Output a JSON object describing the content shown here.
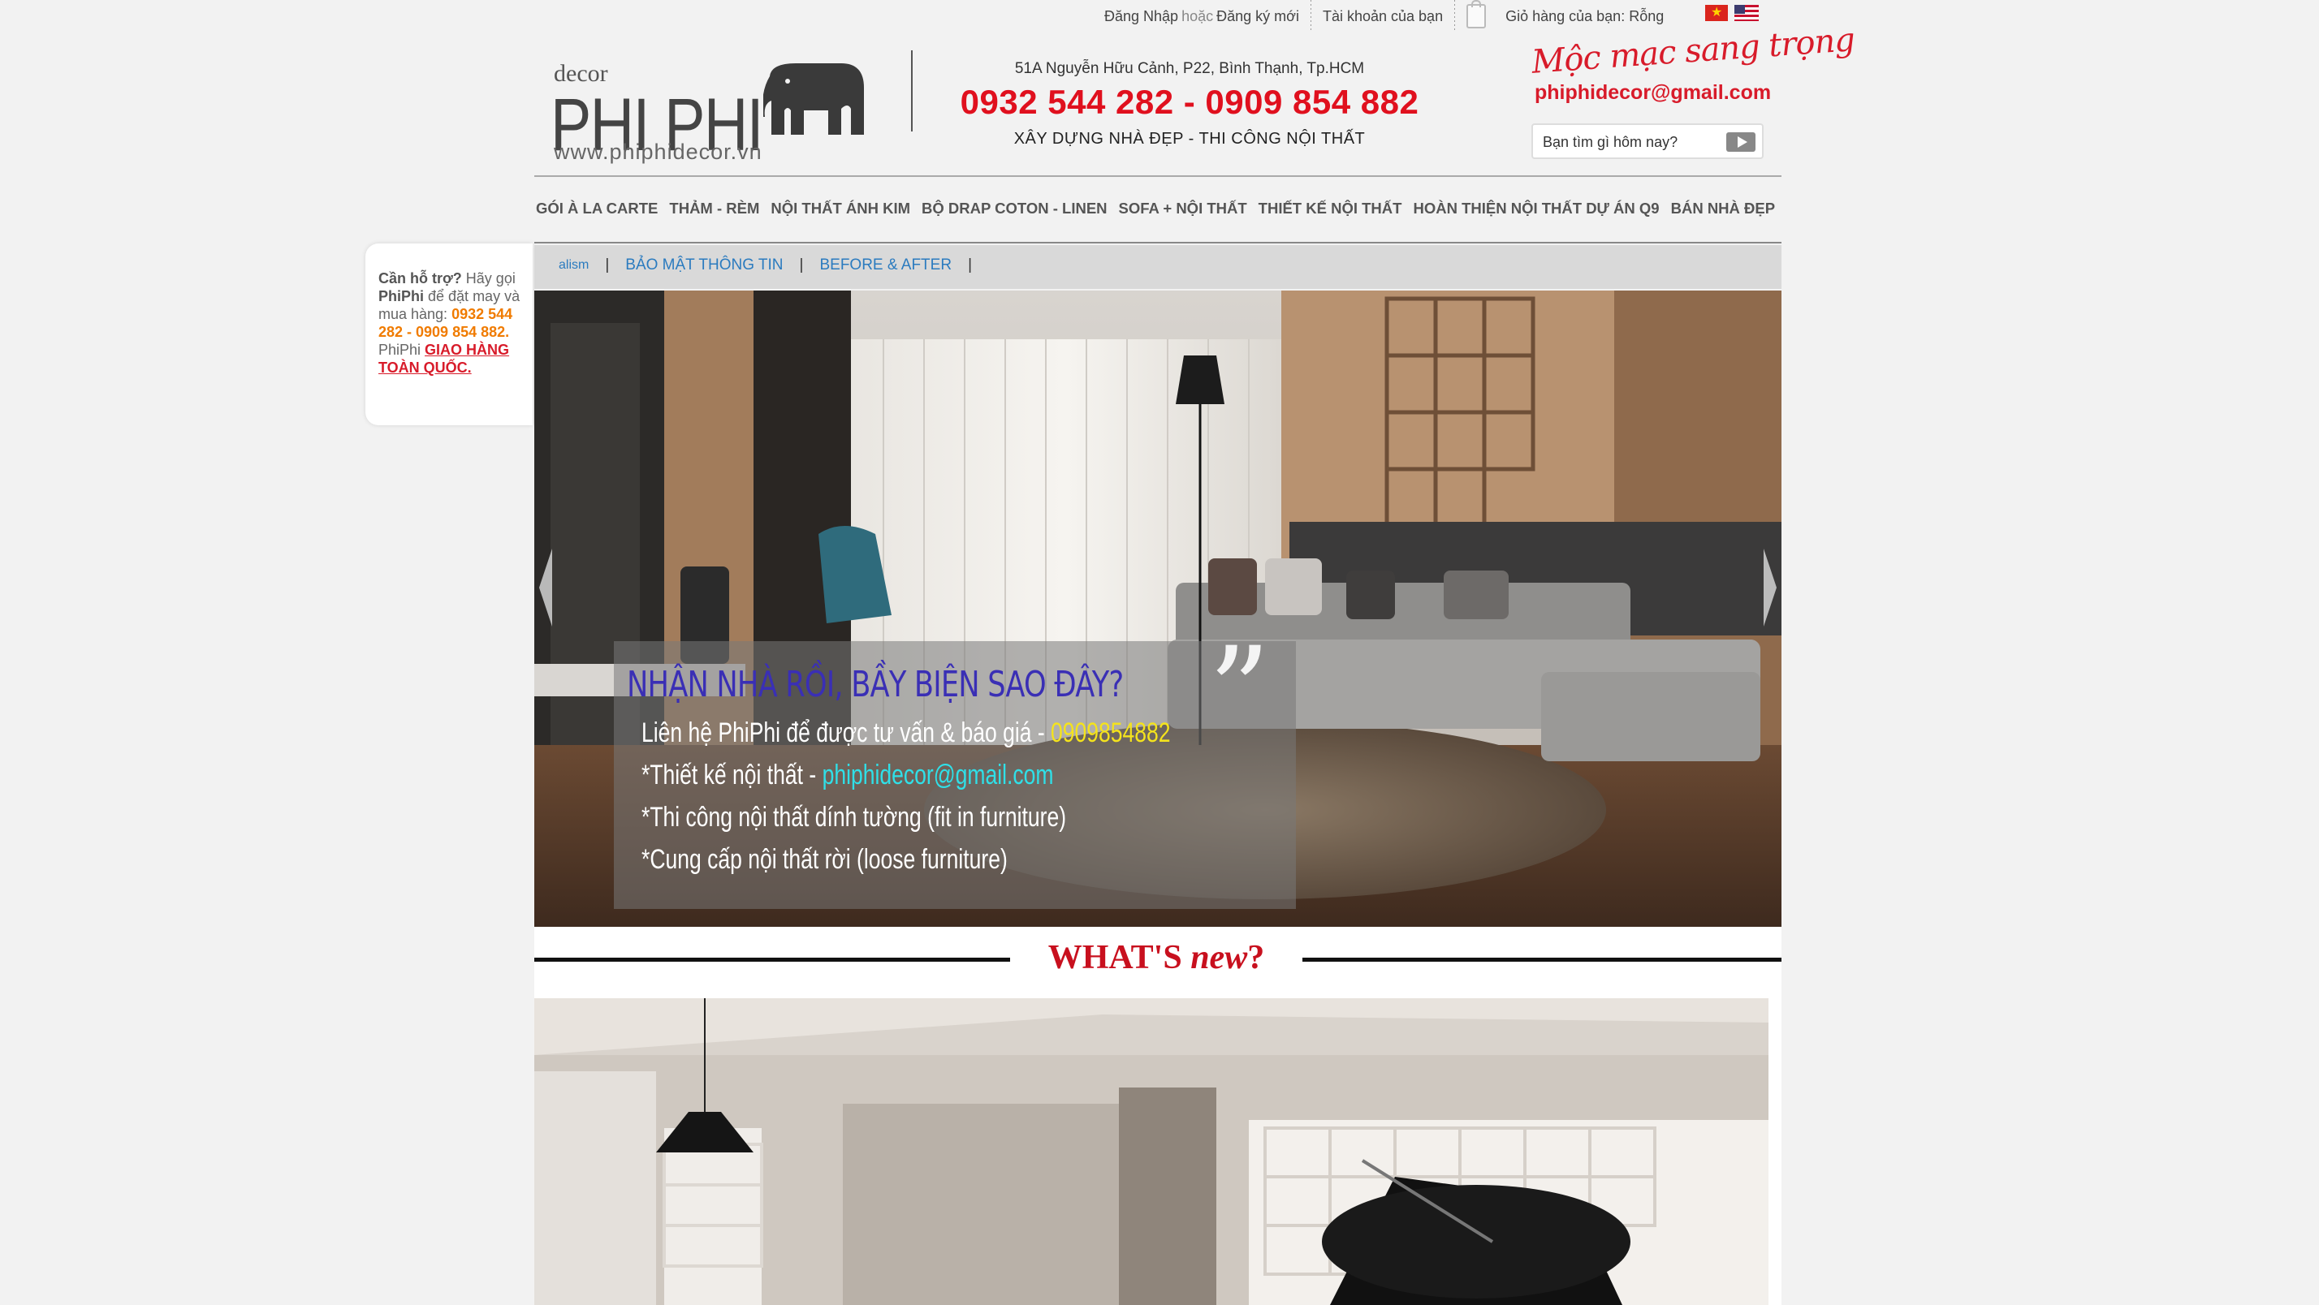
{
  "topbar": {
    "login": "Đăng Nhập",
    "or": "hoặc",
    "register": "Đăng ký mới",
    "account": "Tài khoản của bạn",
    "cart": "Giỏ hàng của bạn: Rỗng"
  },
  "header": {
    "logo_decor": "decor",
    "logo_name": "PHI PHI",
    "logo_url": "www.phiphidecor.vn",
    "address": "51A Nguyễn Hữu Cảnh, P22, Bình Thạnh, Tp.HCM",
    "phones": "0932 544 282 - 0909 854 882",
    "slogan": "XÂY DỰNG NHÀ ĐẸP - THI CÔNG NỘI THẤT",
    "script_tagline": "Mộc mạc sang trọng",
    "email": "phiphidecor@gmail.com"
  },
  "search": {
    "placeholder": "Bạn tìm gì hôm nay?"
  },
  "main_nav": [
    "GÓI À LA CARTE",
    "THẢM - RÈM",
    "NỘI THẤT ÁNH KIM",
    "BỘ DRAP COTON - LINEN",
    "SOFA + NỘI THẤT",
    "THIẾT KẾ NỘI THẤT",
    "HOÀN THIỆN NỘI THẤT DỰ ÁN Q9",
    "BÁN NHÀ ĐẸP"
  ],
  "sub_nav": {
    "partial": "alism",
    "item1": "BẢO MẬT THÔNG TIN",
    "item2": "BEFORE & AFTER",
    "sep": "|"
  },
  "support": {
    "q": "Cần hỗ trợ?",
    "t1": " Hãy gọi ",
    "brand": "PhiPhi",
    "t2": " để đặt may và mua hàng: ",
    "phones": "0932 544 282 - 0909 854 882.",
    "t3": " PhiPhi ",
    "ship": "GIAO HÀNG TOÀN QUỐC."
  },
  "hero": {
    "title": "NHẬN NHÀ RỒI, BẦY BIỆN SAO ĐÂY?",
    "line1_a": "Liên hệ PhiPhi để được tư vấn & báo giá - ",
    "line1_phone": "0909854882",
    "line2_a": "*Thiết kế nội thất  - ",
    "line2_email": "phiphidecor@gmail.com",
    "line3": "*Thi công nội thất dính tường (fit in furniture)",
    "line4": "*Cung cấp nội thất rời (loose furniture)"
  },
  "whats_new": {
    "a": "WHAT'S ",
    "b": "new",
    "c": "?"
  },
  "colors": {
    "brand_red": "#e0101e",
    "link_blue": "#2b7bbf",
    "support_orange": "#f07b00"
  },
  "icons": [
    "cart-bag-icon",
    "flag-vn-icon",
    "flag-us-icon",
    "search-play-icon",
    "elephant-logo-icon",
    "slider-left-arrow-icon",
    "slider-right-arrow-icon"
  ]
}
